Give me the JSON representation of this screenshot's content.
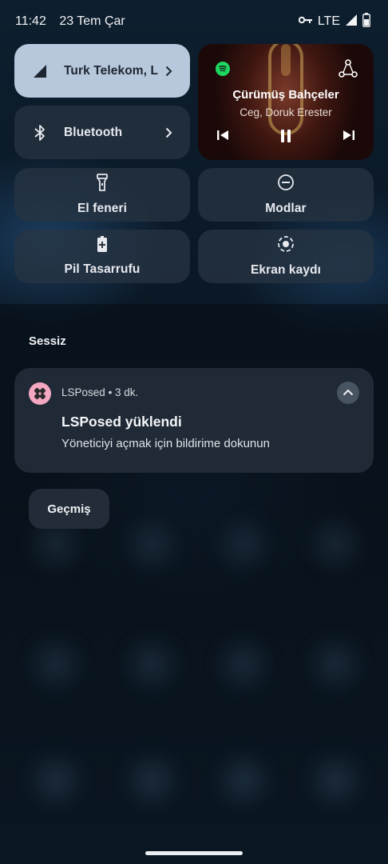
{
  "status": {
    "time": "11:42",
    "date": "23 Tem Çar",
    "network": "LTE"
  },
  "tiles": {
    "mobile": {
      "label": "Turk Telekom, L",
      "icon": "signal-icon"
    },
    "bluetooth": {
      "label": "Bluetooth",
      "icon": "bluetooth-icon"
    },
    "flashlight": {
      "label": "El feneri",
      "icon": "flashlight-icon"
    },
    "modes": {
      "label": "Modlar",
      "icon": "minus-circle-icon"
    },
    "battery_saver": {
      "label": "Pil Tasarrufu",
      "icon": "battery-saver-icon"
    },
    "screen_record": {
      "label": "Ekran kaydı",
      "icon": "screen-record-icon"
    }
  },
  "media": {
    "title": "Çürümüş Bahçeler",
    "artist": "Ceg, Doruk Erester",
    "app_icon": "spotify-icon",
    "output_icon": "cast-icon"
  },
  "notifications": {
    "section_label": "Sessiz",
    "items": [
      {
        "app": "LSPosed",
        "time": "• 3 dk.",
        "title": "LSPosed yüklendi",
        "body": "Yöneticiyi açmak için bildirime dokunun"
      }
    ]
  },
  "history_label": "Geçmiş",
  "colors": {
    "active_tile": "#b8c8dc",
    "spotify": "#1ed760",
    "lsposed_icon": "#f3a7c0"
  }
}
